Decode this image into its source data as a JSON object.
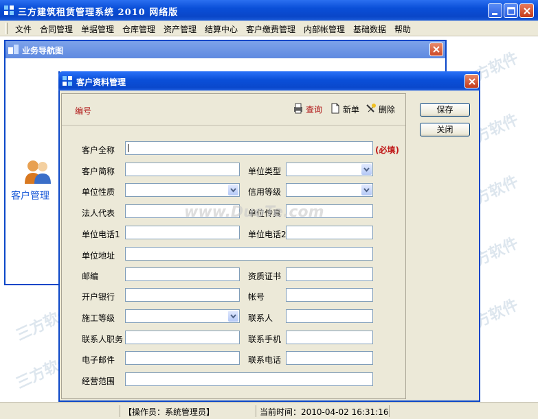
{
  "app": {
    "title": "三方建筑租赁管理系统 2010 网络版"
  },
  "menu": [
    "文件",
    "合同管理",
    "单据管理",
    "仓库管理",
    "资产管理",
    "结算中心",
    "客户缴费管理",
    "内部帐管理",
    "基础数据",
    "帮助"
  ],
  "nav_window": {
    "title": "业务导航图",
    "item_label": "客户管理"
  },
  "dialog": {
    "title": "客户资料管理",
    "code_label": "编号",
    "toolbar": {
      "query": "查询",
      "new": "新单",
      "delete": "删除"
    },
    "side_buttons": {
      "save": "保存",
      "close": "关闭"
    },
    "required_note": "(必填)",
    "fields": {
      "full_name": "客户全称",
      "short_name": "客户简称",
      "unit_type": "单位类型",
      "unit_nature": "单位性质",
      "credit_level": "信用等级",
      "legal_rep": "法人代表",
      "unit_fax": "单位传真",
      "unit_phone1": "单位电话1",
      "unit_phone2": "单位电话2",
      "unit_address": "单位地址",
      "postcode": "邮编",
      "qualification": "资质证书",
      "bank": "开户银行",
      "account": "帐号",
      "construction_level": "施工等级",
      "contact": "联系人",
      "contact_position": "联系人职务",
      "contact_mobile": "联系手机",
      "email": "电子邮件",
      "contact_phone": "联系电话",
      "business_scope": "经营范围"
    }
  },
  "status": {
    "operator": "【操作员：系统管理员】",
    "time": "当前时间：2010-04-02   16:31:16"
  },
  "watermarks": {
    "site": "www.DuoTe.com",
    "brand": "三方软件"
  }
}
